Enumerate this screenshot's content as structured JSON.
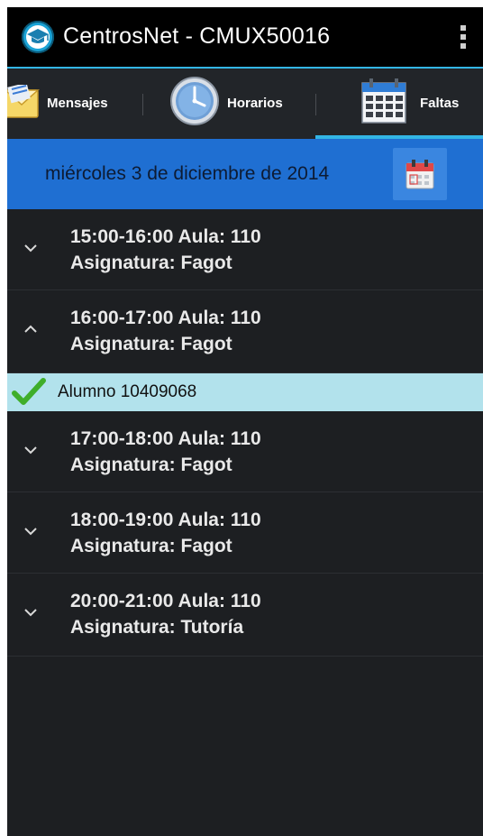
{
  "app": {
    "title": "CentrosNet - CMUX50016"
  },
  "tabs": [
    {
      "label": "Mensajes",
      "icon": "envelope-icon"
    },
    {
      "label": "Horarios",
      "icon": "clock-icon"
    },
    {
      "label": "Faltas",
      "icon": "calendar-grid-icon",
      "selected": true
    }
  ],
  "date": {
    "text": "miércoles 3 de diciembre de 2014",
    "button_icon": "calendar-icon"
  },
  "sessions": [
    {
      "time": "15:00-16:00 Aula: 110",
      "subject": "Asignatura: Fagot",
      "expanded": false
    },
    {
      "time": "16:00-17:00 Aula: 110",
      "subject": "Asignatura: Fagot",
      "expanded": true,
      "students": [
        "Alumno 10409068"
      ]
    },
    {
      "time": "17:00-18:00 Aula: 110",
      "subject": "Asignatura: Fagot",
      "expanded": false
    },
    {
      "time": "18:00-19:00 Aula: 110",
      "subject": "Asignatura: Fagot",
      "expanded": false
    },
    {
      "time": "20:00-21:00 Aula: 110",
      "subject": "Asignatura: Tutoría",
      "expanded": false
    }
  ],
  "colors": {
    "accent": "#33b5e5",
    "date_bar": "#1f6fd2",
    "child_row": "#b2e2ec",
    "check": "#3fae2a"
  }
}
